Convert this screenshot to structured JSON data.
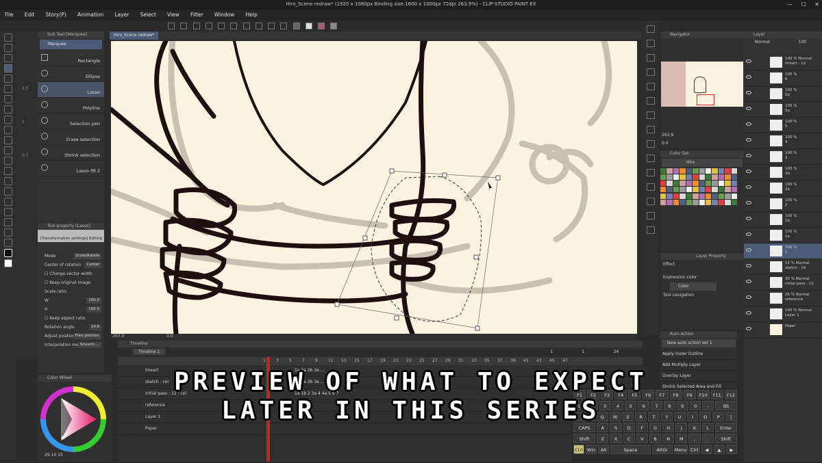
{
  "window_title": "Hiro_Scene redraw* (1920 x 1080px Binding size:1800 x 1000px 72dpi 263.9%) - CLIP STUDIO PAINT EX",
  "menu": [
    "File",
    "Edit",
    "Story(P)",
    "Animation",
    "Layer",
    "Select",
    "View",
    "Filter",
    "Window",
    "Help"
  ],
  "canvas_tab": "Hiro_Scene redraw*",
  "sub_tool": {
    "header": "Sub Tool [Marquee]",
    "group": "Marquee",
    "items": [
      "Rectangle",
      "Ellipse",
      "Lasso",
      "Polyline",
      "Selection pen",
      "Erase selection",
      "Shrink selection",
      "Lasso fill 2"
    ],
    "selected": "Lasso"
  },
  "tool_property": {
    "header": "Tool property [Lasso]",
    "banner": "[Transformation settings] Editing (",
    "mode_label": "Mode",
    "mode_value": "Scale/Rotate",
    "center_label": "Center of rotation",
    "center_value": "Center",
    "change_vector": "Change vector width",
    "keep_original": "Keep original image",
    "scale_ratio": "Scale ratio",
    "w_label": "W",
    "w_value": "100.0",
    "h_label": "H",
    "h_value": "100.0",
    "keep_aspect": "Keep aspect ratio",
    "rotation_label": "Rotation angle",
    "rotation_value": "14.6",
    "adjust_label": "Adjust position",
    "adjust_value": "Free position",
    "interp_label": "Interpolation method",
    "interp_value": "Smooth ..."
  },
  "color_wheel_header": "Color Wheel",
  "color_values": [
    "29",
    "10",
    "15"
  ],
  "canvas_zoom": "263.9",
  "canvas_angle": "0.0",
  "timeline": {
    "header": "Timeline",
    "name": "Timeline 1",
    "ruler": [
      "1",
      "3",
      "5",
      "7",
      "9",
      "11",
      "13",
      "15",
      "17",
      "19",
      "21",
      "23",
      "25",
      "27",
      "29",
      "31",
      "33",
      "35",
      "37",
      "39",
      "41",
      "43",
      "45",
      "47"
    ],
    "right_counters": [
      "1",
      "1",
      "24"
    ],
    "layers": [
      {
        "name": "lineart",
        "frames": "1a 2a 2b 3a ..."
      },
      {
        "name": "sketch : cel",
        "frames": "1a 2a 2b 3a ..."
      },
      {
        "name": "initial pass : 12 : cel",
        "frames": "1a 1b 2 3a 4 4a 5 6 7"
      },
      {
        "name": "reference",
        "frames": ""
      },
      {
        "name": "Layer 1",
        "frames": ""
      },
      {
        "name": "Paper",
        "frames": ""
      }
    ]
  },
  "navigator": {
    "header": "Navigator",
    "zoom": "263.9",
    "angle": "0.0"
  },
  "color_set": {
    "header": "Color Set",
    "name": "Hiro"
  },
  "layer_property": {
    "header": "Layer Property",
    "effect": "Effect",
    "expression_label": "Expression color",
    "expression_value": "Color",
    "tool_nav": "Tool navigation"
  },
  "auto_action": {
    "header": "Auto Action",
    "set": "New auto action set 1",
    "items": [
      "Apply Outer Outline",
      "Add Multiply Layer",
      "Overlay Layer",
      "Shrink Selected Area and Fill"
    ]
  },
  "layers_panel": {
    "header": "Layer",
    "blend": "Normal",
    "opacity": "100",
    "items": [
      {
        "pct": "100 % Normal",
        "name": "lineart : 12"
      },
      {
        "pct": "100 %",
        "name": "6"
      },
      {
        "pct": "100 %",
        "name": "5b"
      },
      {
        "pct": "100 %",
        "name": "5a"
      },
      {
        "pct": "100 %",
        "name": "5"
      },
      {
        "pct": "100 %",
        "name": "4"
      },
      {
        "pct": "100 %",
        "name": "3"
      },
      {
        "pct": "100 %",
        "name": "2b"
      },
      {
        "pct": "100 %",
        "name": "2a"
      },
      {
        "pct": "100 %",
        "name": "2"
      },
      {
        "pct": "100 %",
        "name": "1b"
      },
      {
        "pct": "100 %",
        "name": "1a"
      },
      {
        "pct": "100 %",
        "name": "1"
      },
      {
        "pct": "15 % Normal",
        "name": "sketch : 14"
      },
      {
        "pct": "30 % Normal",
        "name": "initial pass : 12"
      },
      {
        "pct": "25 % Normal",
        "name": "reference"
      },
      {
        "pct": "100 % Normal",
        "name": "Layer 1"
      },
      {
        "pct": "",
        "name": "Paper"
      }
    ]
  },
  "keyboard": {
    "rows": [
      [
        "F1",
        "F2",
        "F3",
        "F4",
        "F5",
        "F6",
        "F7",
        "F8",
        "F9",
        "F10",
        "F11",
        "F12"
      ],
      [
        "1",
        "2",
        "3",
        "4",
        "5",
        "6",
        "7",
        "8",
        "9",
        "0",
        "-",
        "BS"
      ],
      [
        "Tab",
        "Q",
        "W",
        "E",
        "R",
        "T",
        "Y",
        "U",
        "I",
        "O",
        "P",
        "["
      ],
      [
        "CAPS",
        "A",
        "S",
        "D",
        "F",
        "G",
        "H",
        "J",
        "K",
        "L",
        "Enter"
      ],
      [
        "Shift",
        "Z",
        "X",
        "C",
        "V",
        "B",
        "N",
        "M",
        ",",
        ".",
        "Shift"
      ],
      [
        "Ctrl",
        "Win",
        "Alt",
        "Space",
        "AltGr",
        "Menu",
        "Ctrl",
        "◀",
        "▲",
        "▶"
      ]
    ]
  },
  "overlay_caption": [
    "PREVIEW OF WHAT TO EXPECT",
    "LATER IN THIS SERIES"
  ]
}
